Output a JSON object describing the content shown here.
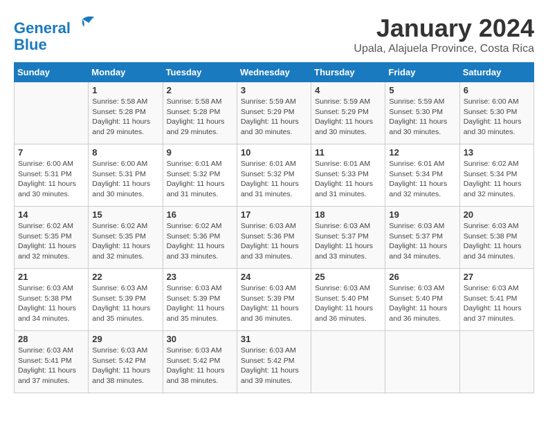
{
  "header": {
    "logo_line1": "General",
    "logo_line2": "Blue",
    "month_title": "January 2024",
    "location": "Upala, Alajuela Province, Costa Rica"
  },
  "days_of_week": [
    "Sunday",
    "Monday",
    "Tuesday",
    "Wednesday",
    "Thursday",
    "Friday",
    "Saturday"
  ],
  "weeks": [
    [
      {
        "day": "",
        "sunrise": "",
        "sunset": "",
        "daylight": ""
      },
      {
        "day": "1",
        "sunrise": "Sunrise: 5:58 AM",
        "sunset": "Sunset: 5:28 PM",
        "daylight": "Daylight: 11 hours and 29 minutes."
      },
      {
        "day": "2",
        "sunrise": "Sunrise: 5:58 AM",
        "sunset": "Sunset: 5:28 PM",
        "daylight": "Daylight: 11 hours and 29 minutes."
      },
      {
        "day": "3",
        "sunrise": "Sunrise: 5:59 AM",
        "sunset": "Sunset: 5:29 PM",
        "daylight": "Daylight: 11 hours and 30 minutes."
      },
      {
        "day": "4",
        "sunrise": "Sunrise: 5:59 AM",
        "sunset": "Sunset: 5:29 PM",
        "daylight": "Daylight: 11 hours and 30 minutes."
      },
      {
        "day": "5",
        "sunrise": "Sunrise: 5:59 AM",
        "sunset": "Sunset: 5:30 PM",
        "daylight": "Daylight: 11 hours and 30 minutes."
      },
      {
        "day": "6",
        "sunrise": "Sunrise: 6:00 AM",
        "sunset": "Sunset: 5:30 PM",
        "daylight": "Daylight: 11 hours and 30 minutes."
      }
    ],
    [
      {
        "day": "7",
        "sunrise": "Sunrise: 6:00 AM",
        "sunset": "Sunset: 5:31 PM",
        "daylight": "Daylight: 11 hours and 30 minutes."
      },
      {
        "day": "8",
        "sunrise": "Sunrise: 6:00 AM",
        "sunset": "Sunset: 5:31 PM",
        "daylight": "Daylight: 11 hours and 30 minutes."
      },
      {
        "day": "9",
        "sunrise": "Sunrise: 6:01 AM",
        "sunset": "Sunset: 5:32 PM",
        "daylight": "Daylight: 11 hours and 31 minutes."
      },
      {
        "day": "10",
        "sunrise": "Sunrise: 6:01 AM",
        "sunset": "Sunset: 5:32 PM",
        "daylight": "Daylight: 11 hours and 31 minutes."
      },
      {
        "day": "11",
        "sunrise": "Sunrise: 6:01 AM",
        "sunset": "Sunset: 5:33 PM",
        "daylight": "Daylight: 11 hours and 31 minutes."
      },
      {
        "day": "12",
        "sunrise": "Sunrise: 6:01 AM",
        "sunset": "Sunset: 5:34 PM",
        "daylight": "Daylight: 11 hours and 32 minutes."
      },
      {
        "day": "13",
        "sunrise": "Sunrise: 6:02 AM",
        "sunset": "Sunset: 5:34 PM",
        "daylight": "Daylight: 11 hours and 32 minutes."
      }
    ],
    [
      {
        "day": "14",
        "sunrise": "Sunrise: 6:02 AM",
        "sunset": "Sunset: 5:35 PM",
        "daylight": "Daylight: 11 hours and 32 minutes."
      },
      {
        "day": "15",
        "sunrise": "Sunrise: 6:02 AM",
        "sunset": "Sunset: 5:35 PM",
        "daylight": "Daylight: 11 hours and 32 minutes."
      },
      {
        "day": "16",
        "sunrise": "Sunrise: 6:02 AM",
        "sunset": "Sunset: 5:36 PM",
        "daylight": "Daylight: 11 hours and 33 minutes."
      },
      {
        "day": "17",
        "sunrise": "Sunrise: 6:03 AM",
        "sunset": "Sunset: 5:36 PM",
        "daylight": "Daylight: 11 hours and 33 minutes."
      },
      {
        "day": "18",
        "sunrise": "Sunrise: 6:03 AM",
        "sunset": "Sunset: 5:37 PM",
        "daylight": "Daylight: 11 hours and 33 minutes."
      },
      {
        "day": "19",
        "sunrise": "Sunrise: 6:03 AM",
        "sunset": "Sunset: 5:37 PM",
        "daylight": "Daylight: 11 hours and 34 minutes."
      },
      {
        "day": "20",
        "sunrise": "Sunrise: 6:03 AM",
        "sunset": "Sunset: 5:38 PM",
        "daylight": "Daylight: 11 hours and 34 minutes."
      }
    ],
    [
      {
        "day": "21",
        "sunrise": "Sunrise: 6:03 AM",
        "sunset": "Sunset: 5:38 PM",
        "daylight": "Daylight: 11 hours and 34 minutes."
      },
      {
        "day": "22",
        "sunrise": "Sunrise: 6:03 AM",
        "sunset": "Sunset: 5:39 PM",
        "daylight": "Daylight: 11 hours and 35 minutes."
      },
      {
        "day": "23",
        "sunrise": "Sunrise: 6:03 AM",
        "sunset": "Sunset: 5:39 PM",
        "daylight": "Daylight: 11 hours and 35 minutes."
      },
      {
        "day": "24",
        "sunrise": "Sunrise: 6:03 AM",
        "sunset": "Sunset: 5:39 PM",
        "daylight": "Daylight: 11 hours and 36 minutes."
      },
      {
        "day": "25",
        "sunrise": "Sunrise: 6:03 AM",
        "sunset": "Sunset: 5:40 PM",
        "daylight": "Daylight: 11 hours and 36 minutes."
      },
      {
        "day": "26",
        "sunrise": "Sunrise: 6:03 AM",
        "sunset": "Sunset: 5:40 PM",
        "daylight": "Daylight: 11 hours and 36 minutes."
      },
      {
        "day": "27",
        "sunrise": "Sunrise: 6:03 AM",
        "sunset": "Sunset: 5:41 PM",
        "daylight": "Daylight: 11 hours and 37 minutes."
      }
    ],
    [
      {
        "day": "28",
        "sunrise": "Sunrise: 6:03 AM",
        "sunset": "Sunset: 5:41 PM",
        "daylight": "Daylight: 11 hours and 37 minutes."
      },
      {
        "day": "29",
        "sunrise": "Sunrise: 6:03 AM",
        "sunset": "Sunset: 5:42 PM",
        "daylight": "Daylight: 11 hours and 38 minutes."
      },
      {
        "day": "30",
        "sunrise": "Sunrise: 6:03 AM",
        "sunset": "Sunset: 5:42 PM",
        "daylight": "Daylight: 11 hours and 38 minutes."
      },
      {
        "day": "31",
        "sunrise": "Sunrise: 6:03 AM",
        "sunset": "Sunset: 5:42 PM",
        "daylight": "Daylight: 11 hours and 39 minutes."
      },
      {
        "day": "",
        "sunrise": "",
        "sunset": "",
        "daylight": ""
      },
      {
        "day": "",
        "sunrise": "",
        "sunset": "",
        "daylight": ""
      },
      {
        "day": "",
        "sunrise": "",
        "sunset": "",
        "daylight": ""
      }
    ]
  ]
}
